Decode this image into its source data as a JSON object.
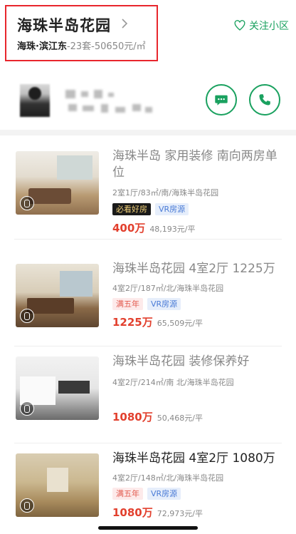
{
  "header": {
    "title": "海珠半岛花园",
    "location": "海珠·滨江东",
    "stats": "-23套-50650元/㎡",
    "follow_label": "关注小区"
  },
  "listings": [
    {
      "title": "海珠半岛 家用装修 南向两房单位",
      "info": "2室1厅/83㎡/南/海珠半岛花园",
      "tags": [
        "必看好房",
        "VR房源"
      ],
      "price": "400万",
      "unit_price": "48,193元/平"
    },
    {
      "title": "海珠半岛花园 4室2厅 1225万",
      "info": "4室2厅/187㎡/北/海珠半岛花园",
      "tags": [
        "满五年",
        "VR房源"
      ],
      "price": "1225万",
      "unit_price": "65,509元/平"
    },
    {
      "title": "海珠半岛花园 装修保养好",
      "info": "4室2厅/214㎡/南 北/海珠半岛花园",
      "tags": [],
      "price": "1080万",
      "unit_price": "50,468元/平"
    },
    {
      "title": "海珠半岛花园 4室2厅 1080万",
      "info": "4室2厅/148㎡/北/海珠半岛花园",
      "tags": [
        "满五年",
        "VR房源"
      ],
      "price": "1080万",
      "unit_price": "72,973元/平"
    }
  ],
  "colors": {
    "accent_green": "#1aa15f",
    "price_red": "#e2402e",
    "highlight_red": "#e8262d"
  },
  "icons": [
    "chevron-right-icon",
    "heart-icon",
    "message-icon",
    "phone-icon",
    "vr-icon"
  ]
}
